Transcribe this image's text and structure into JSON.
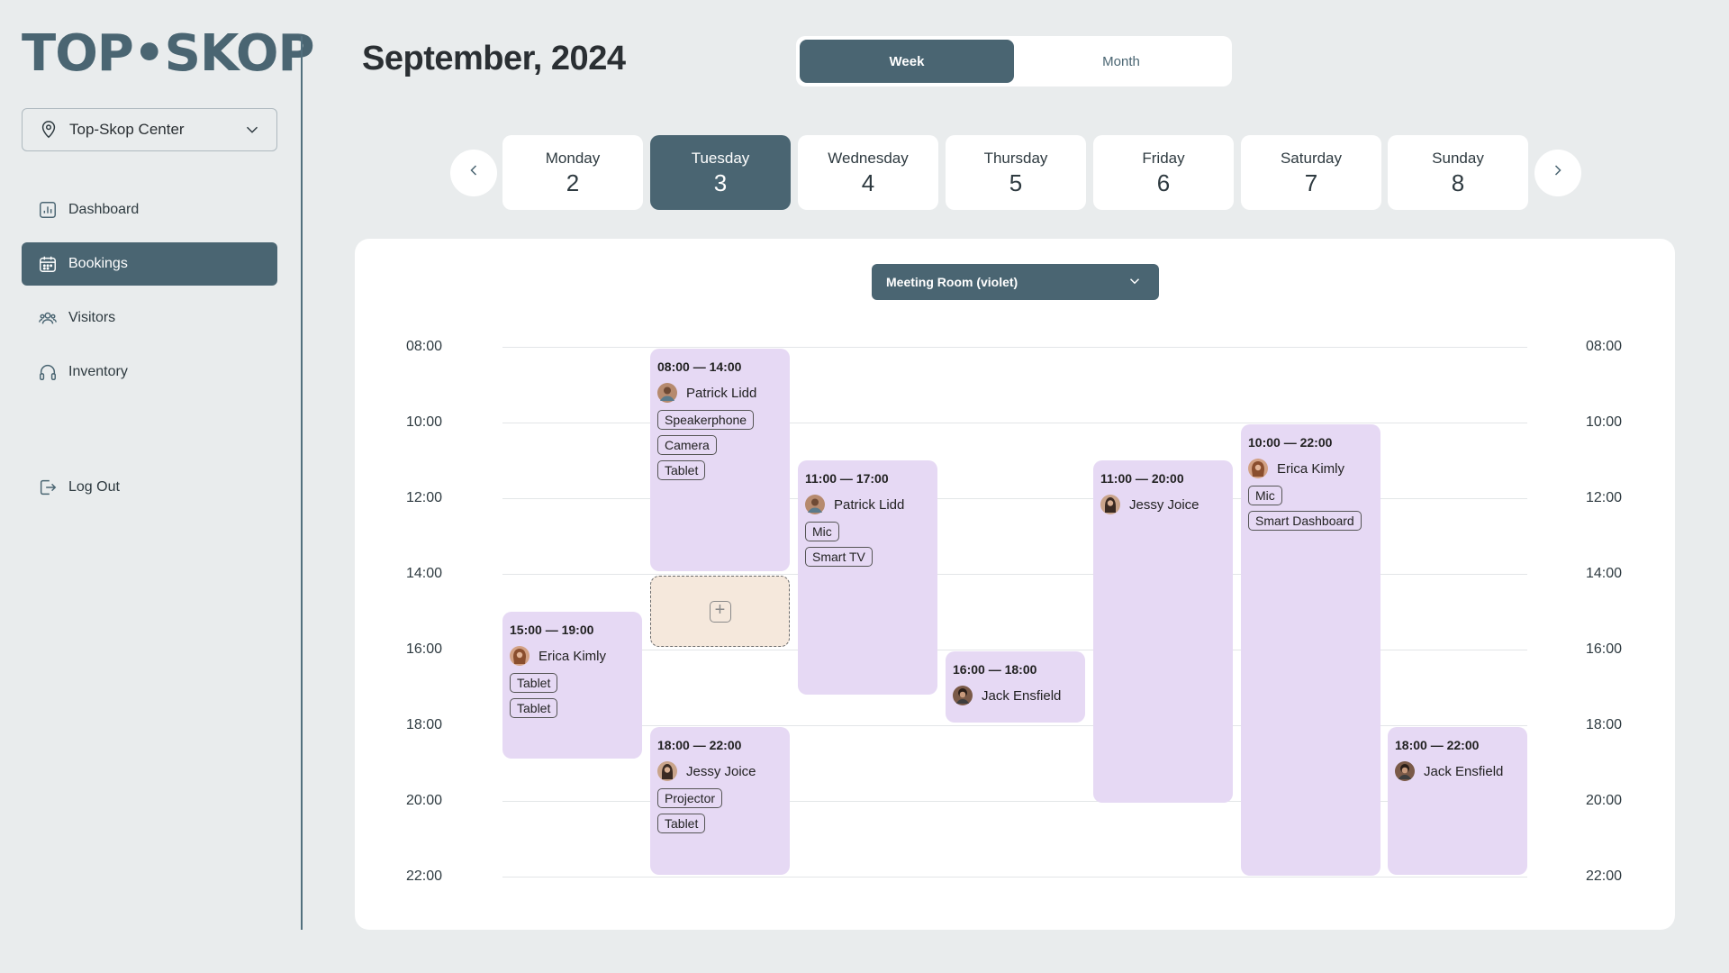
{
  "brand": {
    "logo_text": "TOP•SKOP",
    "accent": "#4A6572"
  },
  "location": {
    "value": "Top-Skop Center",
    "icon": "pin-icon"
  },
  "nav": [
    {
      "label": "Dashboard",
      "icon": "chart-icon",
      "active": false
    },
    {
      "label": "Bookings",
      "icon": "calendar-icon",
      "active": true
    },
    {
      "label": "Visitors",
      "icon": "people-icon",
      "active": false
    },
    {
      "label": "Inventory",
      "icon": "headphones-icon",
      "active": false
    },
    {
      "label": "Log Out",
      "icon": "logout-icon",
      "active": false
    }
  ],
  "header": {
    "title": "September, 2024"
  },
  "view_toggle": {
    "week": "Week",
    "month": "Month",
    "selected": "Week"
  },
  "days": [
    {
      "name": "Monday",
      "num": "2"
    },
    {
      "name": "Tuesday",
      "num": "3",
      "active": true
    },
    {
      "name": "Wednesday",
      "num": "4"
    },
    {
      "name": "Thursday",
      "num": "5"
    },
    {
      "name": "Friday",
      "num": "6"
    },
    {
      "name": "Saturday",
      "num": "7"
    },
    {
      "name": "Sunday",
      "num": "8"
    }
  ],
  "room": {
    "value": "Meeting Room (violet)"
  },
  "times": [
    "08:00",
    "10:00",
    "12:00",
    "14:00",
    "16:00",
    "18:00",
    "20:00",
    "22:00"
  ],
  "events": [
    {
      "time": "08:00 — 14:00",
      "person": "Patrick Lidd",
      "tags": [
        "Speakerphone",
        "Camera",
        "Tablet"
      ]
    },
    {
      "time": "11:00 — 17:00",
      "person": "Patrick Lidd",
      "tags": [
        "Mic",
        "Smart TV"
      ]
    },
    {
      "time": "11:00 — 20:00",
      "person": "Jessy Joice",
      "tags": []
    },
    {
      "time": "10:00 — 22:00",
      "person": "Erica Kimly",
      "tags": [
        "Mic",
        "Smart Dashboard"
      ]
    },
    {
      "time": "15:00 — 19:00",
      "person": "Erica Kimly",
      "tags": [
        "Tablet",
        "Tablet"
      ]
    },
    {
      "time": "16:00 — 18:00",
      "person": "Jack Ensfield",
      "tags": []
    },
    {
      "time": "18:00 — 22:00",
      "person": "Jessy Joice",
      "tags": [
        "Projector",
        "Tablet"
      ]
    },
    {
      "time": "18:00 — 22:00",
      "person": "Jack Ensfield",
      "tags": []
    }
  ],
  "colors": {
    "event_bg": "#E6D9F4",
    "add_slot_bg": "#F5E8DC",
    "page_bg": "#E9ECED"
  }
}
